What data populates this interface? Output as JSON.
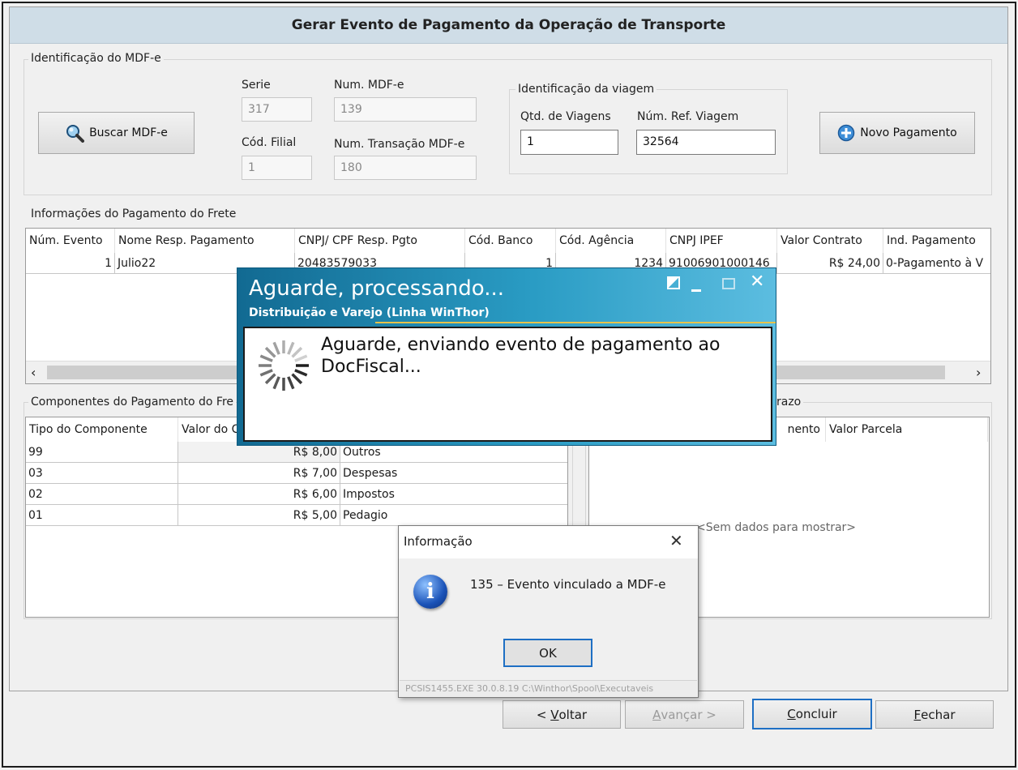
{
  "window": {
    "title": "Gerar Evento de Pagamento da Operação de Transporte"
  },
  "ident_mdfe": {
    "legend": "Identificação do MDF-e",
    "buscar_label": "Buscar MDF-e",
    "serie_label": "Serie",
    "serie_value": "317",
    "num_mdfe_label": "Num. MDF-e",
    "num_mdfe_value": "139",
    "cod_filial_label": "Cód. Filial",
    "cod_filial_value": "1",
    "num_transacao_label": "Num. Transação MDF-e",
    "num_transacao_value": "180"
  },
  "viagem": {
    "legend": "Identificação da viagem",
    "qtd_label": "Qtd. de Viagens",
    "qtd_value": "1",
    "num_ref_label": "Núm. Ref. Viagem",
    "num_ref_value": "32564"
  },
  "novo_pagamento_label": "Novo Pagamento",
  "pagamento_frete": {
    "legend": "Informações do Pagamento do Frete",
    "columns": [
      "Núm. Evento",
      "Nome Resp. Pagamento",
      "CNPJ/ CPF Resp. Pgto",
      "Cód. Banco",
      "Cód. Agência",
      "CNPJ IPEF",
      "Valor Contrato",
      "Ind. Pagamento"
    ],
    "row": [
      "1",
      "Julio22",
      "20483579033",
      "1",
      "1234",
      "91006901000146",
      "R$ 24,00",
      "0-Pagamento à V"
    ]
  },
  "componentes": {
    "legend": "Componentes do Pagamento do Fre",
    "columns": [
      "Tipo do Componente",
      "Valor do C"
    ],
    "rows": [
      [
        "99",
        "R$ 8,00",
        "Outros"
      ],
      [
        "03",
        "R$ 7,00",
        "Despesas"
      ],
      [
        "02",
        "R$ 6,00",
        "Impostos"
      ],
      [
        "01",
        "R$ 5,00",
        "Pedagio"
      ]
    ]
  },
  "prazo": {
    "legend": "razo",
    "columns": [
      "nento",
      "Valor Parcela"
    ],
    "empty": "<Sem dados para mostrar>"
  },
  "buttons": {
    "voltar_pre": "< ",
    "voltar_u": "V",
    "voltar_post": "oltar",
    "avancar_u": "A",
    "avancar_post": "vançar >",
    "concluir_u": "C",
    "concluir_post": "oncluir",
    "fechar_u": "F",
    "fechar_post": "echar"
  },
  "wait_dialog": {
    "title": "Aguarde, processando...",
    "subtitle": "Distribuição e Varejo (Linha WinThor)",
    "message": "Aguarde, enviando evento de pagamento ao DocFiscal..."
  },
  "info_dialog": {
    "title": "Informação",
    "message": "135 – Evento vinculado a MDF-e",
    "ok_label": "OK",
    "status": "PCSIS1455.EXE 30.0.8.19 C:\\Winthor\\Spool\\Executaveis"
  },
  "colors": {
    "title_bg": "#cfdde7",
    "dialog_teal": "#1f86b0",
    "focus_blue": "#1e6fc4"
  }
}
